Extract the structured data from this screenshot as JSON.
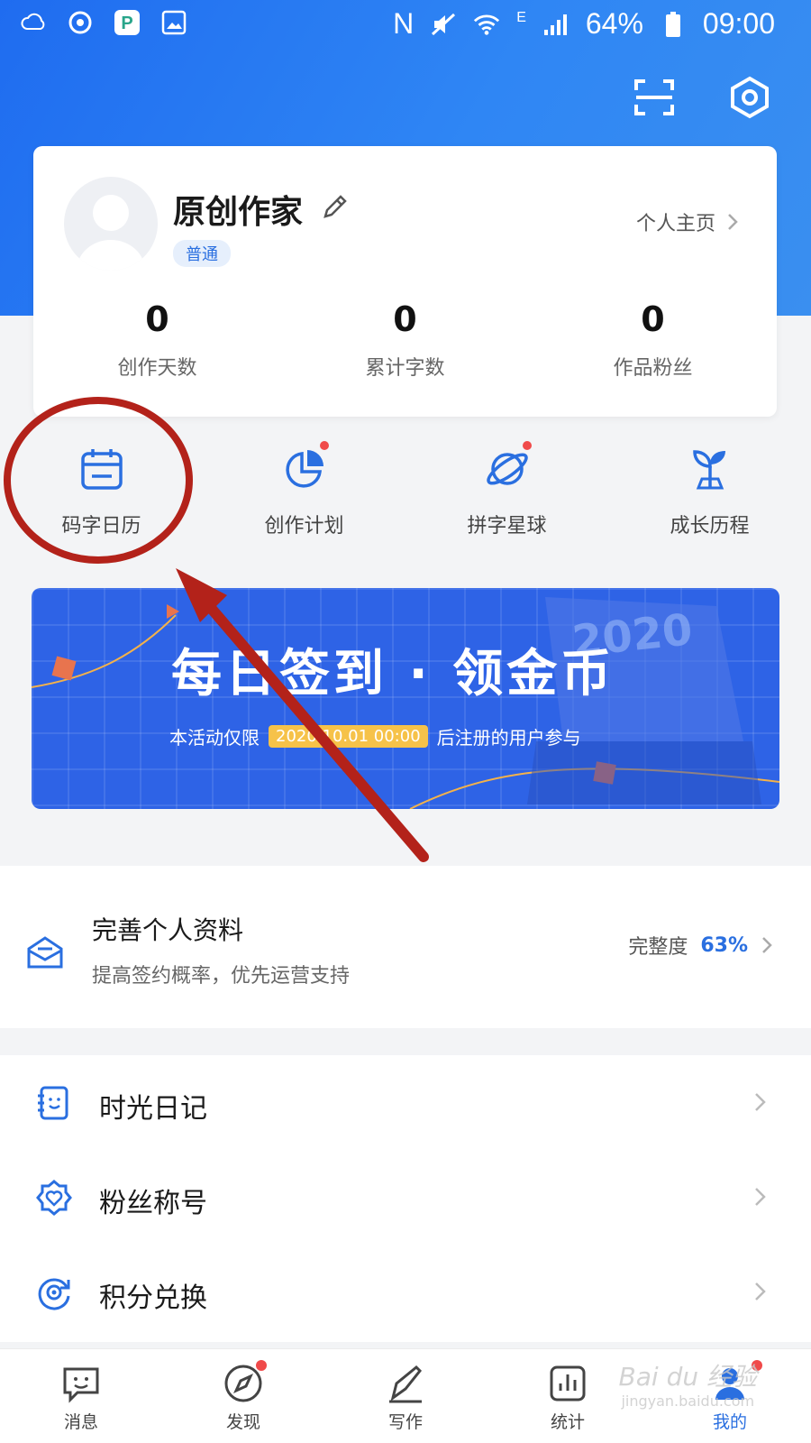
{
  "status_bar": {
    "nfc": "N",
    "net_type": "E",
    "battery": "64%",
    "time": "09:00"
  },
  "header": {
    "scan_icon": "scan-icon",
    "settings_icon": "settings-hexagon-icon"
  },
  "profile": {
    "name": "原创作家",
    "level": "普通",
    "homepage_link": "个人主页",
    "stats": [
      {
        "value": "0",
        "label": "创作天数"
      },
      {
        "value": "0",
        "label": "累计字数"
      },
      {
        "value": "0",
        "label": "作品粉丝"
      }
    ]
  },
  "quick_actions": [
    {
      "label": "码字日历",
      "icon": "calendar-icon",
      "dot": false
    },
    {
      "label": "创作计划",
      "icon": "pie-chart-icon",
      "dot": true
    },
    {
      "label": "拼字星球",
      "icon": "planet-icon",
      "dot": true
    },
    {
      "label": "成长历程",
      "icon": "sprout-icon",
      "dot": false
    }
  ],
  "banner": {
    "year": "2020",
    "title": "每日签到 · 领金币",
    "sub_prefix": "本活动仅限",
    "sub_date": "2020.10.01 00:00",
    "sub_suffix": "后注册的用户参与"
  },
  "profile_complete": {
    "title": "完善个人资料",
    "subtitle": "提高签约概率，优先运营支持",
    "label": "完整度",
    "percent": "63%"
  },
  "menu": [
    {
      "label": "时光日记",
      "icon": "diary-icon"
    },
    {
      "label": "粉丝称号",
      "icon": "fan-badge-icon"
    },
    {
      "label": "积分兑换",
      "icon": "points-exchange-icon"
    }
  ],
  "tabs": [
    {
      "label": "消息",
      "icon": "message-icon",
      "dot": false
    },
    {
      "label": "发现",
      "icon": "compass-icon",
      "dot": true
    },
    {
      "label": "写作",
      "icon": "pen-icon",
      "dot": false
    },
    {
      "label": "统计",
      "icon": "stats-icon",
      "dot": false
    },
    {
      "label": "我的",
      "icon": "user-icon",
      "dot": true,
      "active": true
    }
  ],
  "watermark": {
    "brand": "Bai du 经验",
    "domain": "jingyan.baidu.com"
  },
  "colors": {
    "primary": "#2a6fe0",
    "header_gradient_start": "#1f6cf0",
    "annotation_red": "#b3221a",
    "dot_red": "#f04a4a"
  }
}
